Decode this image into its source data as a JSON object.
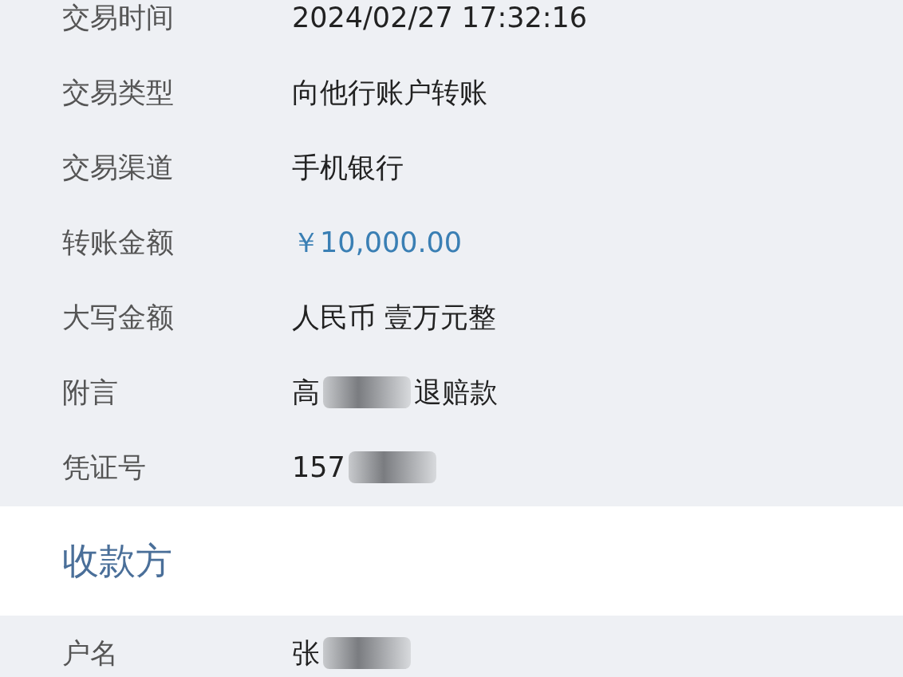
{
  "details": [
    {
      "label": "交易时间",
      "segments": [
        {
          "kind": "text",
          "text": "2024/02/27 17:32:16"
        }
      ]
    },
    {
      "label": "交易类型",
      "segments": [
        {
          "kind": "text",
          "text": "向他行账户转账"
        }
      ]
    },
    {
      "label": "交易渠道",
      "segments": [
        {
          "kind": "text",
          "text": "手机银行"
        }
      ]
    },
    {
      "label": "转账金额",
      "segments": [
        {
          "kind": "amount",
          "text": "￥10,000.00"
        }
      ]
    },
    {
      "label": "大写金额",
      "segments": [
        {
          "kind": "text",
          "text": "人民币 壹万元整"
        }
      ]
    },
    {
      "label": "附言",
      "segments": [
        {
          "kind": "text",
          "text": "高"
        },
        {
          "kind": "blur"
        },
        {
          "kind": "text",
          "text": "退赔款"
        }
      ]
    },
    {
      "label": "凭证号",
      "segments": [
        {
          "kind": "text",
          "text": "157"
        },
        {
          "kind": "blur"
        }
      ]
    }
  ],
  "payee": {
    "title": "收款方",
    "rows": [
      {
        "label": "户名",
        "segments": [
          {
            "kind": "text",
            "text": "张"
          },
          {
            "kind": "blur"
          }
        ]
      }
    ]
  }
}
